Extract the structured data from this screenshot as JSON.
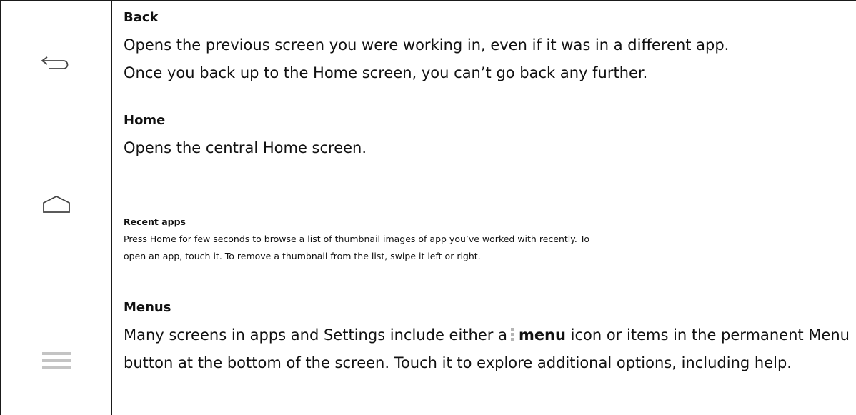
{
  "rows": [
    {
      "icon": "back-arrow-icon",
      "heading": "Back",
      "lines": [
        "Opens the previous screen you were working in, even if it was in a different app.",
        "Once you back up to the Home screen, you can’t go back any further."
      ]
    },
    {
      "icon": "home-icon",
      "heading": "Home",
      "lines": [
        "Opens the central Home screen."
      ],
      "sub_heading": "Recent apps",
      "sub_lines": [
        "Press Home for few seconds to browse a list of thumbnail images of app you’ve worked with recently. To",
        "open an app, touch it. To remove a thumbnail from the list, swipe it left or right."
      ]
    },
    {
      "icon": "menu-lines-icon",
      "heading": "Menus",
      "text_before_icon": "Many screens in apps and Settings include either a",
      "bold_word": "menu",
      "text_after_icon": "icon or items in the permanent Menu button at the bottom of the screen. Touch it to explore additional options, including help.",
      "inline_icon": "menu-dots-icon"
    }
  ],
  "colors": {
    "border": "#1a1a1a",
    "icon_dark": "#444444",
    "icon_light": "#c4c4c4",
    "text": "#111111"
  }
}
